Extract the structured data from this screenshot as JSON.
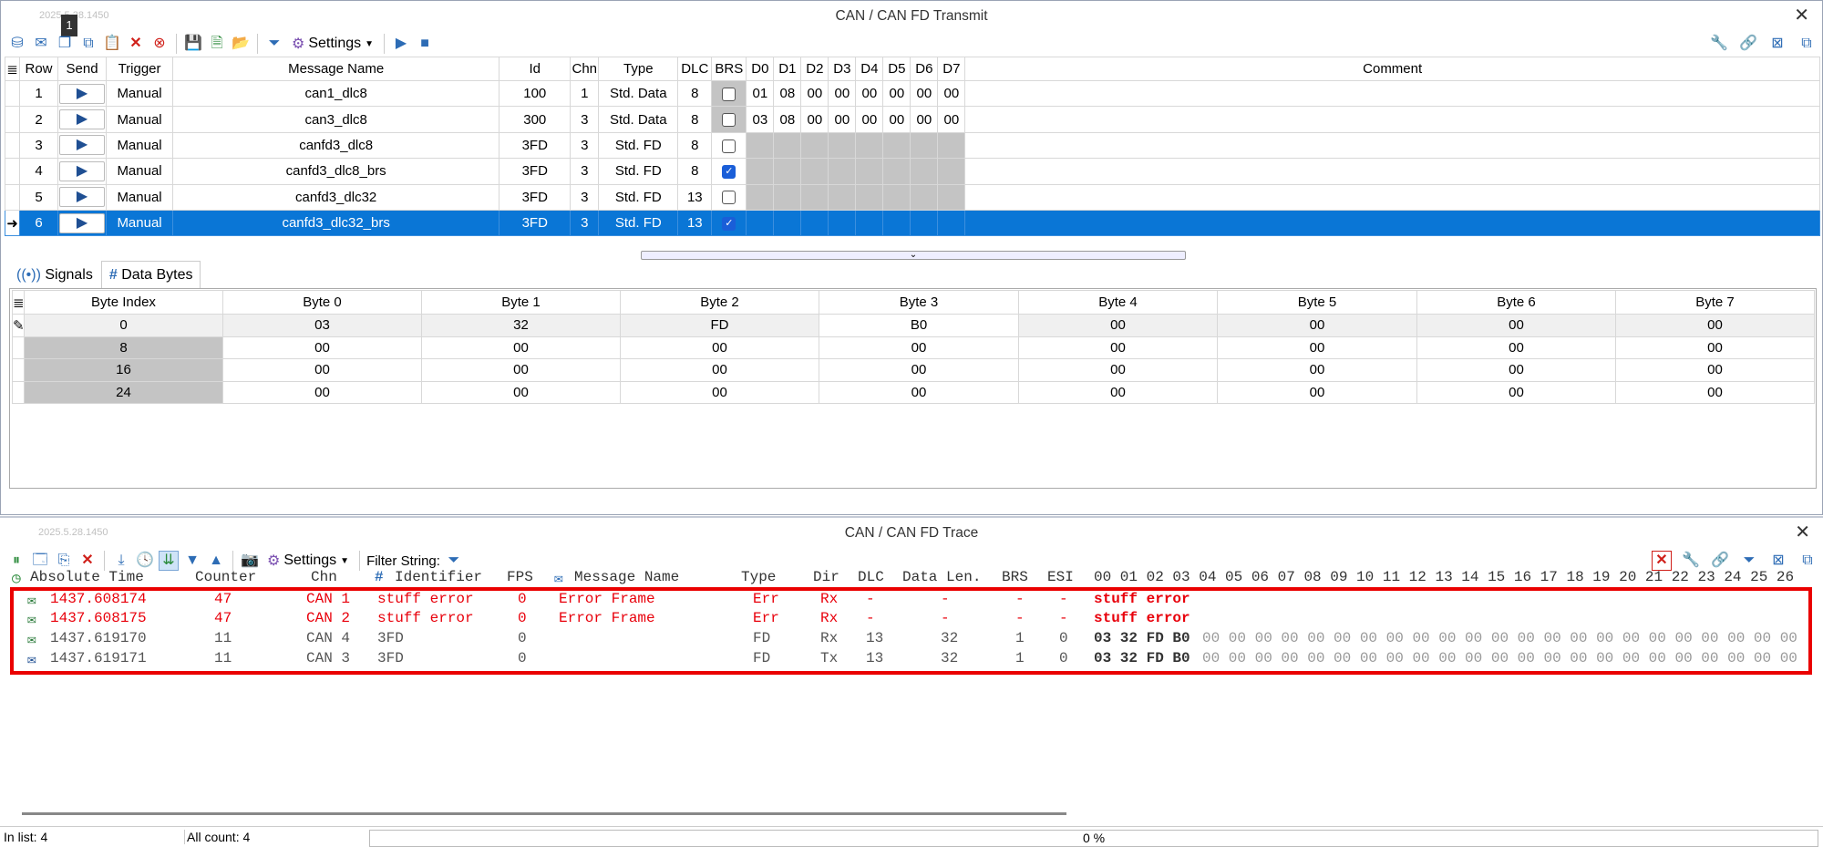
{
  "transmit": {
    "title": "CAN / CAN FD Transmit",
    "version": "2025.5.28.1450",
    "tooltip": "1",
    "settings_label": "Settings",
    "columns": [
      "Row",
      "Send",
      "Trigger",
      "Message Name",
      "Id",
      "Chn",
      "Type",
      "DLC",
      "BRS",
      "D0",
      "D1",
      "D2",
      "D3",
      "D4",
      "D5",
      "D6",
      "D7",
      "Comment"
    ],
    "rows": [
      {
        "row": "1",
        "trigger": "Manual",
        "name": "can1_dlc8",
        "id": "100",
        "chn": "1",
        "type": "Std. Data",
        "dlc": "8",
        "brs": false,
        "d": [
          "01",
          "08",
          "00",
          "00",
          "00",
          "00",
          "00",
          "00"
        ]
      },
      {
        "row": "2",
        "trigger": "Manual",
        "name": "can3_dlc8",
        "id": "300",
        "chn": "3",
        "type": "Std. Data",
        "dlc": "8",
        "brs": false,
        "d": [
          "03",
          "08",
          "00",
          "00",
          "00",
          "00",
          "00",
          "00"
        ]
      },
      {
        "row": "3",
        "trigger": "Manual",
        "name": "canfd3_dlc8",
        "id": "3FD",
        "chn": "3",
        "type": "Std. FD",
        "dlc": "8",
        "brs": false,
        "d": [
          "",
          "",
          "",
          "",
          "",
          "",
          "",
          ""
        ]
      },
      {
        "row": "4",
        "trigger": "Manual",
        "name": "canfd3_dlc8_brs",
        "id": "3FD",
        "chn": "3",
        "type": "Std. FD",
        "dlc": "8",
        "brs": true,
        "d": [
          "",
          "",
          "",
          "",
          "",
          "",
          "",
          ""
        ]
      },
      {
        "row": "5",
        "trigger": "Manual",
        "name": "canfd3_dlc32",
        "id": "3FD",
        "chn": "3",
        "type": "Std. FD",
        "dlc": "13",
        "brs": false,
        "d": [
          "",
          "",
          "",
          "",
          "",
          "",
          "",
          ""
        ]
      },
      {
        "row": "6",
        "trigger": "Manual",
        "name": "canfd3_dlc32_brs",
        "id": "3FD",
        "chn": "3",
        "type": "Std. FD",
        "dlc": "13",
        "brs": true,
        "d": [
          "",
          "",
          "",
          "",
          "",
          "",
          "",
          ""
        ]
      }
    ],
    "selected_row": "6"
  },
  "tabs": {
    "signals": "Signals",
    "data_bytes": "Data Bytes"
  },
  "data_bytes": {
    "columns": [
      "Byte Index",
      "Byte 0",
      "Byte 1",
      "Byte 2",
      "Byte 3",
      "Byte 4",
      "Byte 5",
      "Byte 6",
      "Byte 7"
    ],
    "rows": [
      {
        "index": "0",
        "b": [
          "03",
          "32",
          "FD",
          "B0",
          "00",
          "00",
          "00",
          "00"
        ]
      },
      {
        "index": "8",
        "b": [
          "00",
          "00",
          "00",
          "00",
          "00",
          "00",
          "00",
          "00"
        ]
      },
      {
        "index": "16",
        "b": [
          "00",
          "00",
          "00",
          "00",
          "00",
          "00",
          "00",
          "00"
        ]
      },
      {
        "index": "24",
        "b": [
          "00",
          "00",
          "00",
          "00",
          "00",
          "00",
          "00",
          "00"
        ]
      }
    ]
  },
  "trace": {
    "title": "CAN / CAN FD Trace",
    "version": "2025.5.28.1450",
    "settings_label": "Settings",
    "filter_label": "Filter String:",
    "columns": {
      "time": "Absolute Time",
      "counter": "Counter",
      "chn": "Chn",
      "identifier": "Identifier",
      "fps": "FPS",
      "msgname": "Message Name",
      "type": "Type",
      "dir": "Dir",
      "dlc": "DLC",
      "datalen": "Data Len.",
      "brs": "BRS",
      "esi": "ESI",
      "bytes": "00 01 02 03 04 05 06 07 08 09 10 11 12 13 14 15 16 17 18 19 20 21 22 23 24 25 26"
    },
    "rows": [
      {
        "time": "1437.608174",
        "counter": "47",
        "chn": "CAN 1",
        "id": "stuff error",
        "fps": "0",
        "name": "Error Frame",
        "type": "Err",
        "dir": "Rx",
        "dlc": "-",
        "datalen": "-",
        "brs": "-",
        "esi": "-",
        "bold": "stuff error",
        "rest": ""
      },
      {
        "time": "1437.608175",
        "counter": "47",
        "chn": "CAN 2",
        "id": "stuff error",
        "fps": "0",
        "name": "Error Frame",
        "type": "Err",
        "dir": "Rx",
        "dlc": "-",
        "datalen": "-",
        "brs": "-",
        "esi": "-",
        "bold": "stuff error",
        "rest": ""
      },
      {
        "time": "1437.619170",
        "counter": "11",
        "chn": "CAN 4",
        "id": "3FD",
        "fps": "0",
        "name": "",
        "type": "FD",
        "dir": "Rx",
        "dlc": "13",
        "datalen": "32",
        "brs": "1",
        "esi": "0",
        "bold": "03 32 FD B0",
        "rest": "00 00 00 00 00 00 00 00 00 00 00 00 00 00 00 00 00 00 00 00 00 00 00"
      },
      {
        "time": "1437.619171",
        "counter": "11",
        "chn": "CAN 3",
        "id": "3FD",
        "fps": "0",
        "name": "",
        "type": "FD",
        "dir": "Tx",
        "dlc": "13",
        "datalen": "32",
        "brs": "1",
        "esi": "0",
        "bold": "03 32 FD B0",
        "rest": "00 00 00 00 00 00 00 00 00 00 00 00 00 00 00 00 00 00 00 00 00 00 00"
      }
    ]
  },
  "status": {
    "in_list": "In list: 4",
    "all_count": "All count: 4",
    "progress": "0 %",
    "progress_value": 0
  },
  "colors": {
    "selection": "#0a76d6",
    "error": "#e8000b",
    "highlight_box": "#ea0000"
  }
}
